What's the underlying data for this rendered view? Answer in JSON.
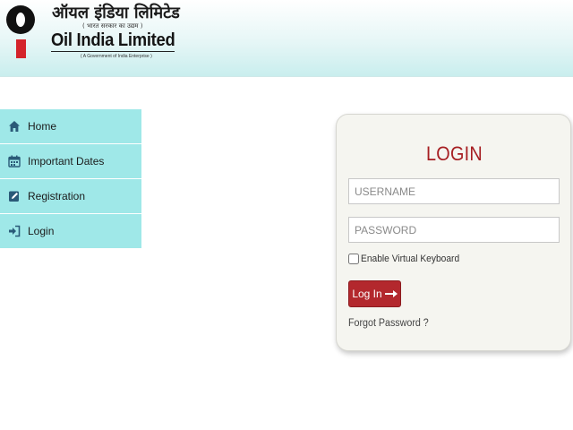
{
  "header": {
    "brand_hindi": "ऑयल इंडिया लिमिटेड",
    "brand_tag": "( भारत सरकार का उद्यम )",
    "brand_english": "Oil India Limited",
    "brand_subtitle": "( A Government of India Enterprise )",
    "logo_icon": "oil-drop-logo-icon"
  },
  "sidebar": {
    "items": [
      {
        "label": "Home",
        "icon": "home-icon"
      },
      {
        "label": "Important Dates",
        "icon": "calendar-icon"
      },
      {
        "label": "Registration",
        "icon": "edit-icon"
      },
      {
        "label": "Login",
        "icon": "sign-in-icon"
      }
    ]
  },
  "login": {
    "title": "LOGIN",
    "username_placeholder": "USERNAME",
    "username_value": "",
    "password_placeholder": "PASSWORD",
    "password_value": "",
    "virtual_keyboard_label": "Enable Virtual Keyboard",
    "virtual_keyboard_checked": false,
    "button_label": "Log In",
    "forgot_label": "Forgot Password ?"
  },
  "colors": {
    "sidebar_bg": "#9fe8e8",
    "accent_red": "#b3282d",
    "title_red": "#a61e22",
    "card_bg": "#f5f5f0"
  }
}
